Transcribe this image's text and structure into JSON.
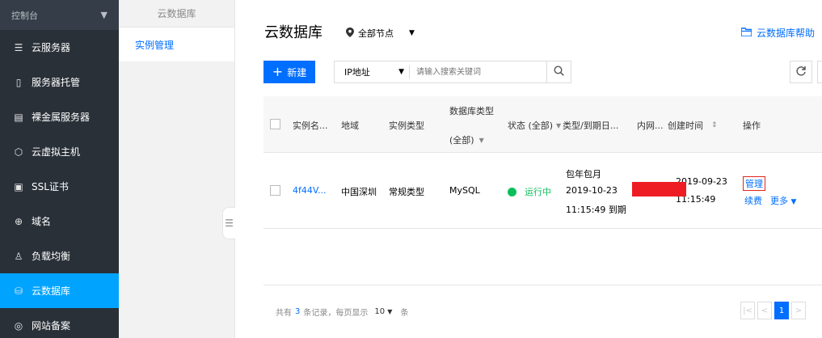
{
  "nav": {
    "console_label": "控制台",
    "items": [
      {
        "label": "云服务器",
        "icon": "server-icon",
        "glyph": "☰",
        "active": false
      },
      {
        "label": "服务器托管",
        "icon": "hosting-icon",
        "glyph": "▯",
        "active": false
      },
      {
        "label": "裸金属服务器",
        "icon": "baremetal-icon",
        "glyph": "▤",
        "active": false
      },
      {
        "label": "云虚拟主机",
        "icon": "vhost-icon",
        "glyph": "⬡",
        "active": false
      },
      {
        "label": "SSL证书",
        "icon": "ssl-icon",
        "glyph": "▣",
        "active": false
      },
      {
        "label": "域名",
        "icon": "globe-icon",
        "glyph": "⊕",
        "active": false
      },
      {
        "label": "负载均衡",
        "icon": "loadbalance-icon",
        "glyph": "♙",
        "active": false
      },
      {
        "label": "云数据库",
        "icon": "database-icon",
        "glyph": "⛁",
        "active": true
      },
      {
        "label": "网站备案",
        "icon": "record-icon",
        "glyph": "◎",
        "active": false
      }
    ]
  },
  "subnav": {
    "title": "云数据库",
    "item": "实例管理"
  },
  "header": {
    "title": "云数据库",
    "region": "全部节点",
    "help": "云数据库帮助"
  },
  "toolbar": {
    "new_label": "新建",
    "search_type": "IP地址",
    "search_placeholder": "请输入搜索关键词"
  },
  "table": {
    "columns": {
      "name": "实例名...",
      "region": "地域",
      "type": "实例类型",
      "db_type_1": "数据库类型",
      "db_type_2": "(全部)",
      "status": "状态 (全部)",
      "expire": "类型/到期日...",
      "ip": "内网...",
      "created": "创建时间",
      "ops": "操作"
    },
    "rows": [
      {
        "name": "4f44V...",
        "region": "中国深圳",
        "type": "常规类型",
        "db": "MySQL",
        "status": "运行中",
        "billing": "包年包月",
        "expire_date": "2019-10-23",
        "expire_time": "11:15:49 到期",
        "created_date": "2019-09-23",
        "created_time": "11:15:49",
        "manage": "管理",
        "renew": "续费",
        "more": "更多"
      }
    ]
  },
  "footer": {
    "prefix": "共有",
    "count": "3",
    "suffix": "条记录，每页显示",
    "page_size": "10",
    "unit": "条",
    "current_page": "1"
  },
  "colors": {
    "accent": "#006eff",
    "nav_bg": "#293038",
    "nav_active": "#00a4ff",
    "running": "#0abf5b",
    "redaction": "#ee1d23"
  }
}
